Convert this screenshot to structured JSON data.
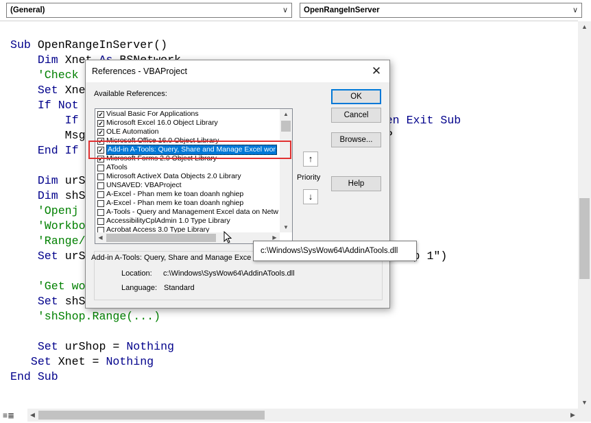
{
  "editor": {
    "object_combo": "(General)",
    "procedure_combo": "OpenRangeInServer",
    "code_lines": [
      [
        {
          "t": "Sub ",
          "c": "kw"
        },
        {
          "t": "OpenRangeInServer()",
          "c": "pl"
        }
      ],
      [
        {
          "t": "    ",
          "c": "pl"
        },
        {
          "t": "Dim ",
          "c": "kw"
        },
        {
          "t": "Xnet ",
          "c": "pl"
        },
        {
          "t": "As ",
          "c": "kw"
        },
        {
          "t": "BSNetwork",
          "c": "pl"
        }
      ],
      [
        {
          "t": "    'Check",
          "c": "cm"
        }
      ],
      [
        {
          "t": "    ",
          "c": "pl"
        },
        {
          "t": "Set ",
          "c": "kw"
        },
        {
          "t": "Xne",
          "c": "pl"
        }
      ],
      [
        {
          "t": "    ",
          "c": "pl"
        },
        {
          "t": "If Not",
          "c": "kw"
        }
      ],
      [
        {
          "t": "        ",
          "c": "pl"
        },
        {
          "t": "If",
          "c": "kw"
        },
        {
          "t": "                                         ) ",
          "c": "pl"
        },
        {
          "t": "Then Exit Sub",
          "c": "kw"
        }
      ],
      [
        {
          "t": "        Msg",
          "c": "pl"
        },
        {
          "t": "                                       moteIP",
          "c": "pl"
        }
      ],
      [
        {
          "t": "    ",
          "c": "pl"
        },
        {
          "t": "End If",
          "c": "kw"
        }
      ],
      [
        {
          "t": "",
          "c": "pl"
        }
      ],
      [
        {
          "t": "    ",
          "c": "pl"
        },
        {
          "t": "Dim ",
          "c": "kw"
        },
        {
          "t": "urS",
          "c": "pl"
        }
      ],
      [
        {
          "t": "    ",
          "c": "pl"
        },
        {
          "t": "Dim ",
          "c": "kw"
        },
        {
          "t": "shS",
          "c": "pl"
        }
      ],
      [
        {
          "t": "    'Openj",
          "c": "cm"
        }
      ],
      [
        {
          "t": "    'Workbo",
          "c": "cm"
        }
      ],
      [
        {
          "t": "    'Range/",
          "c": "cm"
        }
      ],
      [
        {
          "t": "    ",
          "c": "pl"
        },
        {
          "t": "Set ",
          "c": "kw"
        },
        {
          "t": "urS",
          "c": "pl"
        },
        {
          "t": "                                          n(\"Shop 1\")",
          "c": "pl"
        }
      ],
      [
        {
          "t": "",
          "c": "pl"
        }
      ],
      [
        {
          "t": "    'Get wo",
          "c": "cm"
        }
      ],
      [
        {
          "t": "    ",
          "c": "pl"
        },
        {
          "t": "Set ",
          "c": "kw"
        },
        {
          "t": "shS",
          "c": "pl"
        }
      ],
      [
        {
          "t": "    'shShop.Range(...)",
          "c": "cm"
        }
      ],
      [
        {
          "t": "",
          "c": "pl"
        }
      ],
      [
        {
          "t": "    ",
          "c": "pl"
        },
        {
          "t": "Set ",
          "c": "kw"
        },
        {
          "t": "urShop = ",
          "c": "pl"
        },
        {
          "t": "Nothing",
          "c": "kw"
        }
      ],
      [
        {
          "t": "   ",
          "c": "pl"
        },
        {
          "t": "Set ",
          "c": "kw"
        },
        {
          "t": "Xnet = ",
          "c": "pl"
        },
        {
          "t": "Nothing",
          "c": "kw"
        }
      ],
      [
        {
          "t": "End Sub",
          "c": "kw"
        }
      ]
    ]
  },
  "dialog": {
    "title": "References - VBAProject",
    "available_label": "Available References:",
    "references": [
      {
        "label": "Visual Basic For Applications",
        "checked": true,
        "selected": false
      },
      {
        "label": "Microsoft Excel 16.0 Object Library",
        "checked": true,
        "selected": false
      },
      {
        "label": "OLE Automation",
        "checked": true,
        "selected": false
      },
      {
        "label": "Microsoft Office 16.0 Object Library",
        "checked": true,
        "selected": false
      },
      {
        "label": "Add-in A-Tools: Query, Share and Manage Excel wor",
        "checked": true,
        "selected": true
      },
      {
        "label": "Microsoft Forms 2.0 Object Library",
        "checked": true,
        "selected": false
      },
      {
        "label": "ATools",
        "checked": false,
        "selected": false
      },
      {
        "label": "Microsoft ActiveX Data Objects 2.0 Library",
        "checked": false,
        "selected": false
      },
      {
        "label": "UNSAVED: VBAProject",
        "checked": false,
        "selected": false
      },
      {
        "label": "A-Excel - Phan mem ke toan doanh nghiep",
        "checked": false,
        "selected": false
      },
      {
        "label": "A-Excel - Phan mem ke toan doanh nghiep",
        "checked": false,
        "selected": false
      },
      {
        "label": "A-Tools - Query and Management Excel data on Netw",
        "checked": false,
        "selected": false
      },
      {
        "label": "AccessibilityCplAdmin 1.0 Type Library",
        "checked": false,
        "selected": false
      },
      {
        "label": "Acrobat Access 3.0 Type Library",
        "checked": false,
        "selected": false
      }
    ],
    "buttons": {
      "ok": "OK",
      "cancel": "Cancel",
      "browse": "Browse...",
      "help": "Help"
    },
    "priority_label": "Priority",
    "priority_up": "↑",
    "priority_down": "↓",
    "group_title": "Add-in A-Tools: Query, Share and Manage Exce",
    "location_label": "Location:",
    "location_value": "c:\\Windows\\SysWow64\\AddinATools.dll",
    "language_label": "Language:",
    "language_value": "Standard",
    "close_glyph": "✕"
  },
  "tooltip": {
    "text": "c:\\Windows\\SysWow64\\AddinATools.dll"
  },
  "glyphs": {
    "dropdown": "∨",
    "up": "▲",
    "down": "▼",
    "left": "◀",
    "right": "▶",
    "check": "✓",
    "view_icons": "≡≣"
  }
}
